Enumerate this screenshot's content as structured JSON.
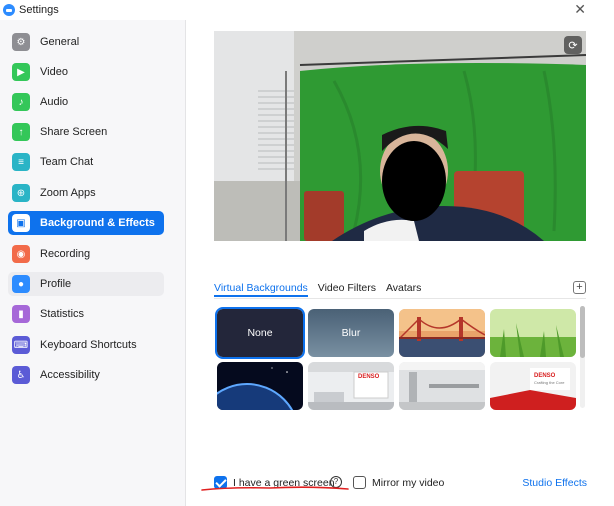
{
  "window": {
    "title": "Settings",
    "close_glyph": "✕"
  },
  "sidebar": {
    "items": [
      {
        "label": "General",
        "icon": "gear-icon",
        "color": "#8e8e93",
        "glyph": "⚙"
      },
      {
        "label": "Video",
        "icon": "video-camera-icon",
        "color": "#34c759",
        "glyph": "▶"
      },
      {
        "label": "Audio",
        "icon": "headphones-icon",
        "color": "#34c759",
        "glyph": "♪"
      },
      {
        "label": "Share Screen",
        "icon": "share-screen-icon",
        "color": "#34c759",
        "glyph": "↑"
      },
      {
        "label": "Team Chat",
        "icon": "chat-icon",
        "color": "#2ab4c6",
        "glyph": "≡"
      },
      {
        "label": "Zoom Apps",
        "icon": "apps-icon",
        "color": "#2ab4c6",
        "glyph": "⊕"
      },
      {
        "label": "Background & Effects",
        "icon": "portrait-icon",
        "color": "#0e72ed",
        "glyph": "▣",
        "active": true
      },
      {
        "label": "Recording",
        "icon": "record-icon",
        "color": "#f26b4a",
        "glyph": "◉"
      },
      {
        "label": "Profile",
        "icon": "profile-icon",
        "color": "#2d8cff",
        "glyph": "●",
        "hover": true
      },
      {
        "label": "Statistics",
        "icon": "bar-chart-icon",
        "color": "#a668d8",
        "glyph": "▮"
      },
      {
        "label": "Keyboard Shortcuts",
        "icon": "keyboard-icon",
        "color": "#5b5bd6",
        "glyph": "⌨"
      },
      {
        "label": "Accessibility",
        "icon": "accessibility-icon",
        "color": "#5b5bd6",
        "glyph": "♿"
      }
    ]
  },
  "preview": {
    "rotate_glyph": "⟳"
  },
  "tabs": [
    {
      "label": "Virtual Backgrounds",
      "active": true
    },
    {
      "label": "Video Filters",
      "active": false
    },
    {
      "label": "Avatars",
      "active": false
    }
  ],
  "add_background_glyph": "+",
  "backgrounds": [
    {
      "label": "None",
      "kind": "none",
      "selected": true
    },
    {
      "label": "Blur",
      "kind": "blur"
    },
    {
      "label": "",
      "kind": "golden-gate"
    },
    {
      "label": "",
      "kind": "grass"
    },
    {
      "label": "",
      "kind": "earth-space"
    },
    {
      "label": "",
      "kind": "office-denso"
    },
    {
      "label": "",
      "kind": "office-interior"
    },
    {
      "label": "",
      "kind": "denso-wall"
    }
  ],
  "denso_logo": {
    "name": "DENSO",
    "tagline": "Crafting the Core"
  },
  "footer": {
    "green_screen_label": "I have a green screen",
    "green_screen_checked": true,
    "help_glyph": "?",
    "mirror_label": "Mirror my video",
    "mirror_checked": false,
    "studio_effects_label": "Studio Effects"
  },
  "colors": {
    "accent": "#0e72ed",
    "annotation_red": "#e02020"
  }
}
